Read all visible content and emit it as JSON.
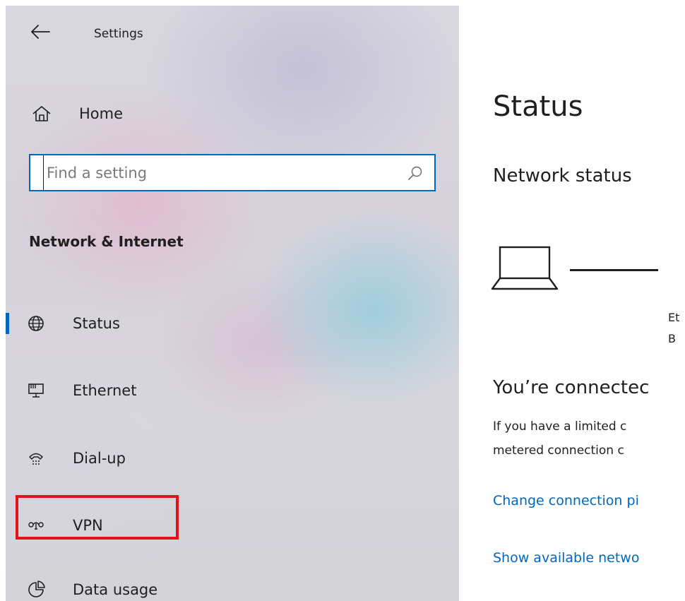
{
  "window": {
    "app_title": "Settings"
  },
  "sidebar": {
    "home_label": "Home",
    "search": {
      "placeholder": "Find a setting",
      "value": ""
    },
    "section_title": "Network & Internet",
    "items": [
      {
        "label": "Status",
        "icon": "globe-icon",
        "active": true
      },
      {
        "label": "Ethernet",
        "icon": "ethernet-icon",
        "active": false
      },
      {
        "label": "Dial-up",
        "icon": "dial-up-icon",
        "active": false
      },
      {
        "label": "VPN",
        "icon": "vpn-icon",
        "active": false,
        "highlighted": true
      },
      {
        "label": "Data usage",
        "icon": "data-usage-icon",
        "active": false
      }
    ]
  },
  "main": {
    "page_title": "Status",
    "network_status_heading": "Network status",
    "adapter_name_partial": "Et",
    "adapter_sub_partial": "B",
    "connected_heading": "You’re connectec",
    "description_line1": "If you have a limited c",
    "description_line2": "metered connection c",
    "link_change_connection": "Change connection pi",
    "link_show_networks": "Show available netwo"
  },
  "colors": {
    "accent": "#0067c0",
    "highlight_box": "#e5101a",
    "text": "#1f1f1f"
  }
}
